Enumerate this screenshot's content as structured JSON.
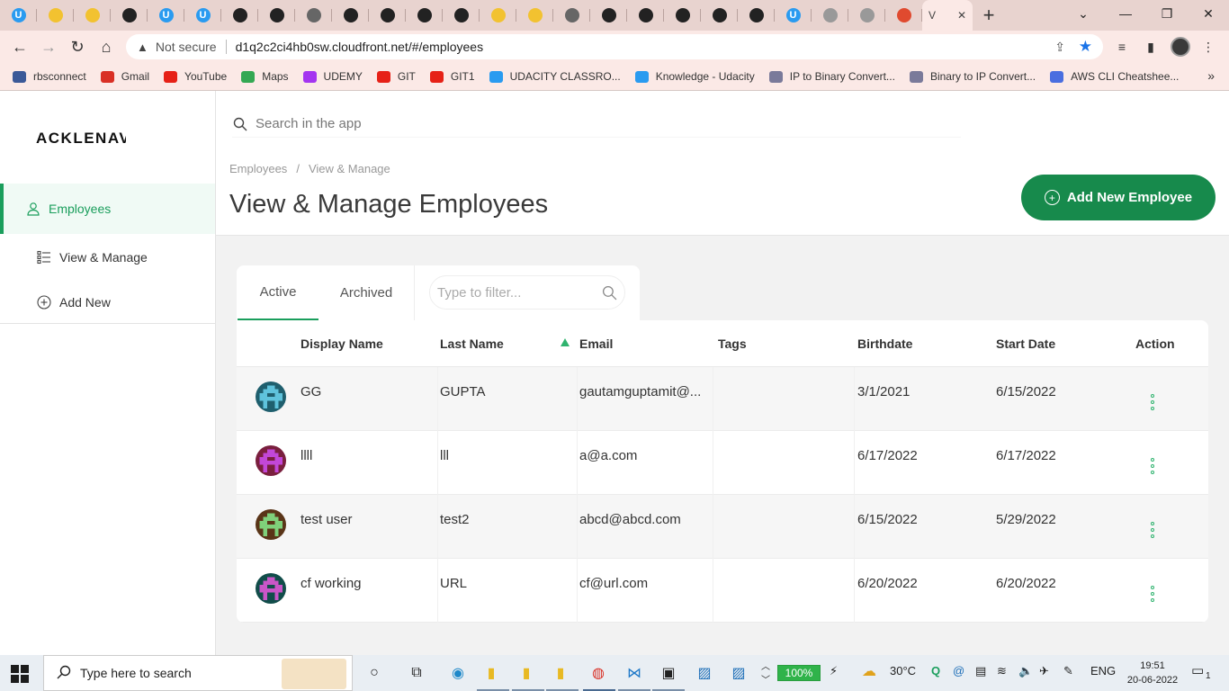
{
  "browser": {
    "tabs": [
      {
        "icon": "udacity-icon",
        "color": "#2a9bf0",
        "glyph": "U"
      },
      {
        "icon": "folder-icon",
        "color": "#f2c230",
        "glyph": ""
      },
      {
        "icon": "folder-icon",
        "color": "#f2c230",
        "glyph": ""
      },
      {
        "icon": "github-icon",
        "color": "#222222",
        "glyph": ""
      },
      {
        "icon": "udacity-icon",
        "color": "#2a9bf0",
        "glyph": "U"
      },
      {
        "icon": "udacity-icon",
        "color": "#2a9bf0",
        "glyph": "U"
      },
      {
        "icon": "record-icon",
        "color": "#222222",
        "glyph": ""
      },
      {
        "icon": "github-icon",
        "color": "#222222",
        "glyph": ""
      },
      {
        "icon": "globe-icon",
        "color": "#666666",
        "glyph": ""
      },
      {
        "icon": "github-icon",
        "color": "#222222",
        "glyph": ""
      },
      {
        "icon": "github-icon",
        "color": "#222222",
        "glyph": ""
      },
      {
        "icon": "github-icon",
        "color": "#222222",
        "glyph": ""
      },
      {
        "icon": "github-icon",
        "color": "#222222",
        "glyph": ""
      },
      {
        "icon": "document-icon",
        "color": "#f2c230",
        "glyph": ""
      },
      {
        "icon": "document-icon",
        "color": "#f2c230",
        "glyph": ""
      },
      {
        "icon": "globe-icon",
        "color": "#666666",
        "glyph": ""
      },
      {
        "icon": "github-icon",
        "color": "#222222",
        "glyph": ""
      },
      {
        "icon": "github-icon",
        "color": "#222222",
        "glyph": ""
      },
      {
        "icon": "github-icon",
        "color": "#222222",
        "glyph": ""
      },
      {
        "icon": "github-icon",
        "color": "#222222",
        "glyph": ""
      },
      {
        "icon": "github-icon",
        "color": "#222222",
        "glyph": ""
      },
      {
        "icon": "udacity-icon",
        "color": "#2a9bf0",
        "glyph": "U"
      },
      {
        "icon": "globe-icon",
        "color": "#999999",
        "glyph": ""
      },
      {
        "icon": "globe-icon",
        "color": "#999999",
        "glyph": ""
      },
      {
        "icon": "microphone-icon",
        "color": "#e04a2f",
        "glyph": ""
      }
    ],
    "active_tab": {
      "label": "V",
      "close": "✕"
    },
    "new_tab": "+",
    "address": {
      "security": "Not secure",
      "url": "d1q2c2ci4hb0sw.cloudfront.net/#/employees"
    },
    "bookmarks": [
      {
        "label": "rbsconnect",
        "icon": "rbs-icon",
        "color": "#3b5998"
      },
      {
        "label": "Gmail",
        "icon": "gmail-icon",
        "color": "#d93025"
      },
      {
        "label": "YouTube",
        "icon": "youtube-icon",
        "color": "#e62117"
      },
      {
        "label": "Maps",
        "icon": "maps-icon",
        "color": "#34a853"
      },
      {
        "label": "UDEMY",
        "icon": "udemy-icon",
        "color": "#a435f0"
      },
      {
        "label": "GIT",
        "icon": "youtube-icon",
        "color": "#e62117"
      },
      {
        "label": "GIT1",
        "icon": "youtube-icon",
        "color": "#e62117"
      },
      {
        "label": "UDACITY CLASSRO...",
        "icon": "udacity-icon",
        "color": "#2a9bf0"
      },
      {
        "label": "Knowledge - Udacity",
        "icon": "udacity-icon",
        "color": "#2a9bf0"
      },
      {
        "label": "IP to Binary Convert...",
        "icon": "ufo-icon",
        "color": "#7a7a9a"
      },
      {
        "label": "Binary to IP Convert...",
        "icon": "ufo-icon",
        "color": "#7a7a9a"
      },
      {
        "label": "AWS CLI Cheatshee...",
        "icon": "aws-icon",
        "color": "#4a6ee0"
      }
    ],
    "bookmarks_more": "»"
  },
  "app": {
    "logo": "ACKLENAVENUE",
    "nav": {
      "employees": "Employees",
      "view_manage": "View & Manage",
      "add_new": "Add New"
    },
    "search_placeholder": "Search in the app",
    "breadcrumb": [
      "Employees",
      "View & Manage"
    ],
    "breadcrumb_sep": "/",
    "page_title": "View & Manage Employees",
    "add_button": "Add New Employee",
    "tabs": {
      "active": "Active",
      "archived": "Archived"
    },
    "filter_placeholder": "Type to filter...",
    "table": {
      "columns": [
        "Display Name",
        "Last Name",
        "Email",
        "Tags",
        "Birthdate",
        "Start Date",
        "Action"
      ],
      "sorted_column": "Email",
      "sort_direction": "ascending",
      "rows": [
        {
          "display_name": "GG",
          "last_name": "GUPTA",
          "email": "gautamguptamit@...",
          "tags": "",
          "birthdate": "3/1/2021",
          "start_date": "6/15/2022",
          "avatar_bg": "#1f5f6e",
          "avatar_fg": "#5fc3dc"
        },
        {
          "display_name": "llll",
          "last_name": "lll",
          "email": "a@a.com",
          "tags": "",
          "birthdate": "6/17/2022",
          "start_date": "6/17/2022",
          "avatar_bg": "#7a1f3e",
          "avatar_fg": "#c247d8"
        },
        {
          "display_name": "test user",
          "last_name": "test2",
          "email": "abcd@abcd.com",
          "tags": "",
          "birthdate": "6/15/2022",
          "start_date": "5/29/2022",
          "avatar_bg": "#5a3518",
          "avatar_fg": "#7fd07a"
        },
        {
          "display_name": "cf working",
          "last_name": "URL",
          "email": "cf@url.com",
          "tags": "",
          "birthdate": "6/20/2022",
          "start_date": "6/20/2022",
          "avatar_bg": "#114d4a",
          "avatar_fg": "#c956c8"
        }
      ]
    },
    "accent": "#178a4c"
  },
  "taskbar": {
    "search_placeholder": "Type here to search",
    "battery": "100%",
    "weather": "30°C",
    "language": "ENG",
    "time": "19:51",
    "date": "20-06-2022",
    "notifications": "1"
  }
}
